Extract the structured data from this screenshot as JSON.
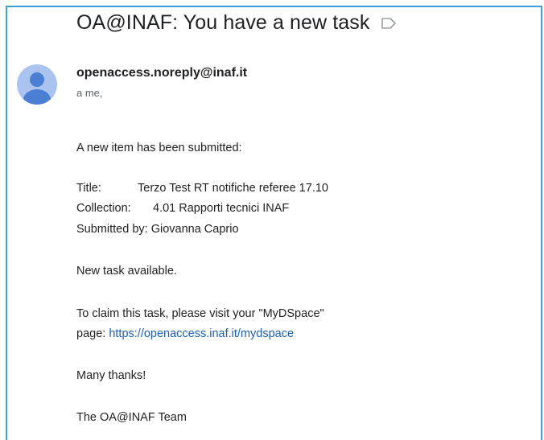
{
  "email": {
    "subject": "OA@INAF: You have a new task",
    "label_icon": "label-arrow-icon",
    "sender": "openaccess.noreply@inaf.it",
    "recipient": "a me,",
    "avatar_icon": "default-user-avatar-icon",
    "body": {
      "intro": "A new item has been submitted:",
      "title_label": "Title:",
      "title_value": "Terzo Test RT notifiche referee 17.10",
      "collection_label": "Collection:",
      "collection_value": "4.01 Rapporti tecnici INAF",
      "submitted_label": "Submitted by:",
      "submitted_value": "Giovanna Caprio",
      "task_line": "New task available.",
      "claim_line_1": "To claim this task, please visit your \"MyDSpace\"",
      "claim_line_2_prefix": "page:",
      "claim_link": "https://openaccess.inaf.it/mydspace",
      "thanks": "Many thanks!",
      "signature": "The OA@INAF Team"
    }
  },
  "colors": {
    "frame_border": "#3aa0d8",
    "avatar_bg": "#aac4ef",
    "avatar_fg": "#4a7fd4",
    "link": "#1a5fb4"
  }
}
